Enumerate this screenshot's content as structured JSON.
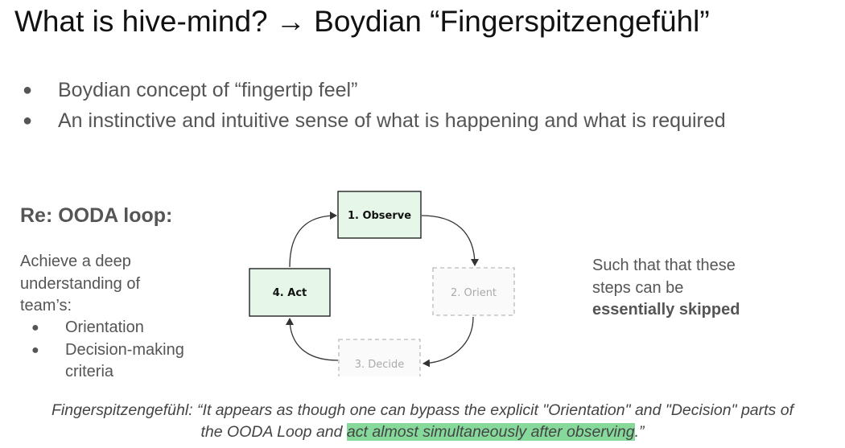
{
  "title": "What is hive-mind? → Boydian “Fingerspitzengefühl”",
  "bullets": [
    "Boydian concept of “fingertip feel”",
    "An instinctive and intuitive sense of what is happening and what is required"
  ],
  "ooda": {
    "heading": "Re: OODA loop:",
    "intro_lines": [
      "Achieve a deep",
      "understanding of",
      "team’s:"
    ],
    "items": [
      "Orientation",
      "Decision-making criteria"
    ]
  },
  "diagram": {
    "observe": "1. Observe",
    "orient": "2. Orient",
    "decide": "3. Decide",
    "act": "4. Act"
  },
  "right": {
    "line1": "Such that that these",
    "line2": "steps can be",
    "emphasis": "essentially skipped"
  },
  "quote": {
    "before": "Fingerspitzengefühl: “It appears as though one can bypass the explicit \"Orientation\" and \"Decision\" parts of",
    "line2_before": "the OODA Loop and ",
    "highlight": "act almost simultaneously after observing",
    "after": ".”"
  },
  "colors": {
    "active_fill": "#e6f7ea",
    "highlight": "#86d99b"
  }
}
